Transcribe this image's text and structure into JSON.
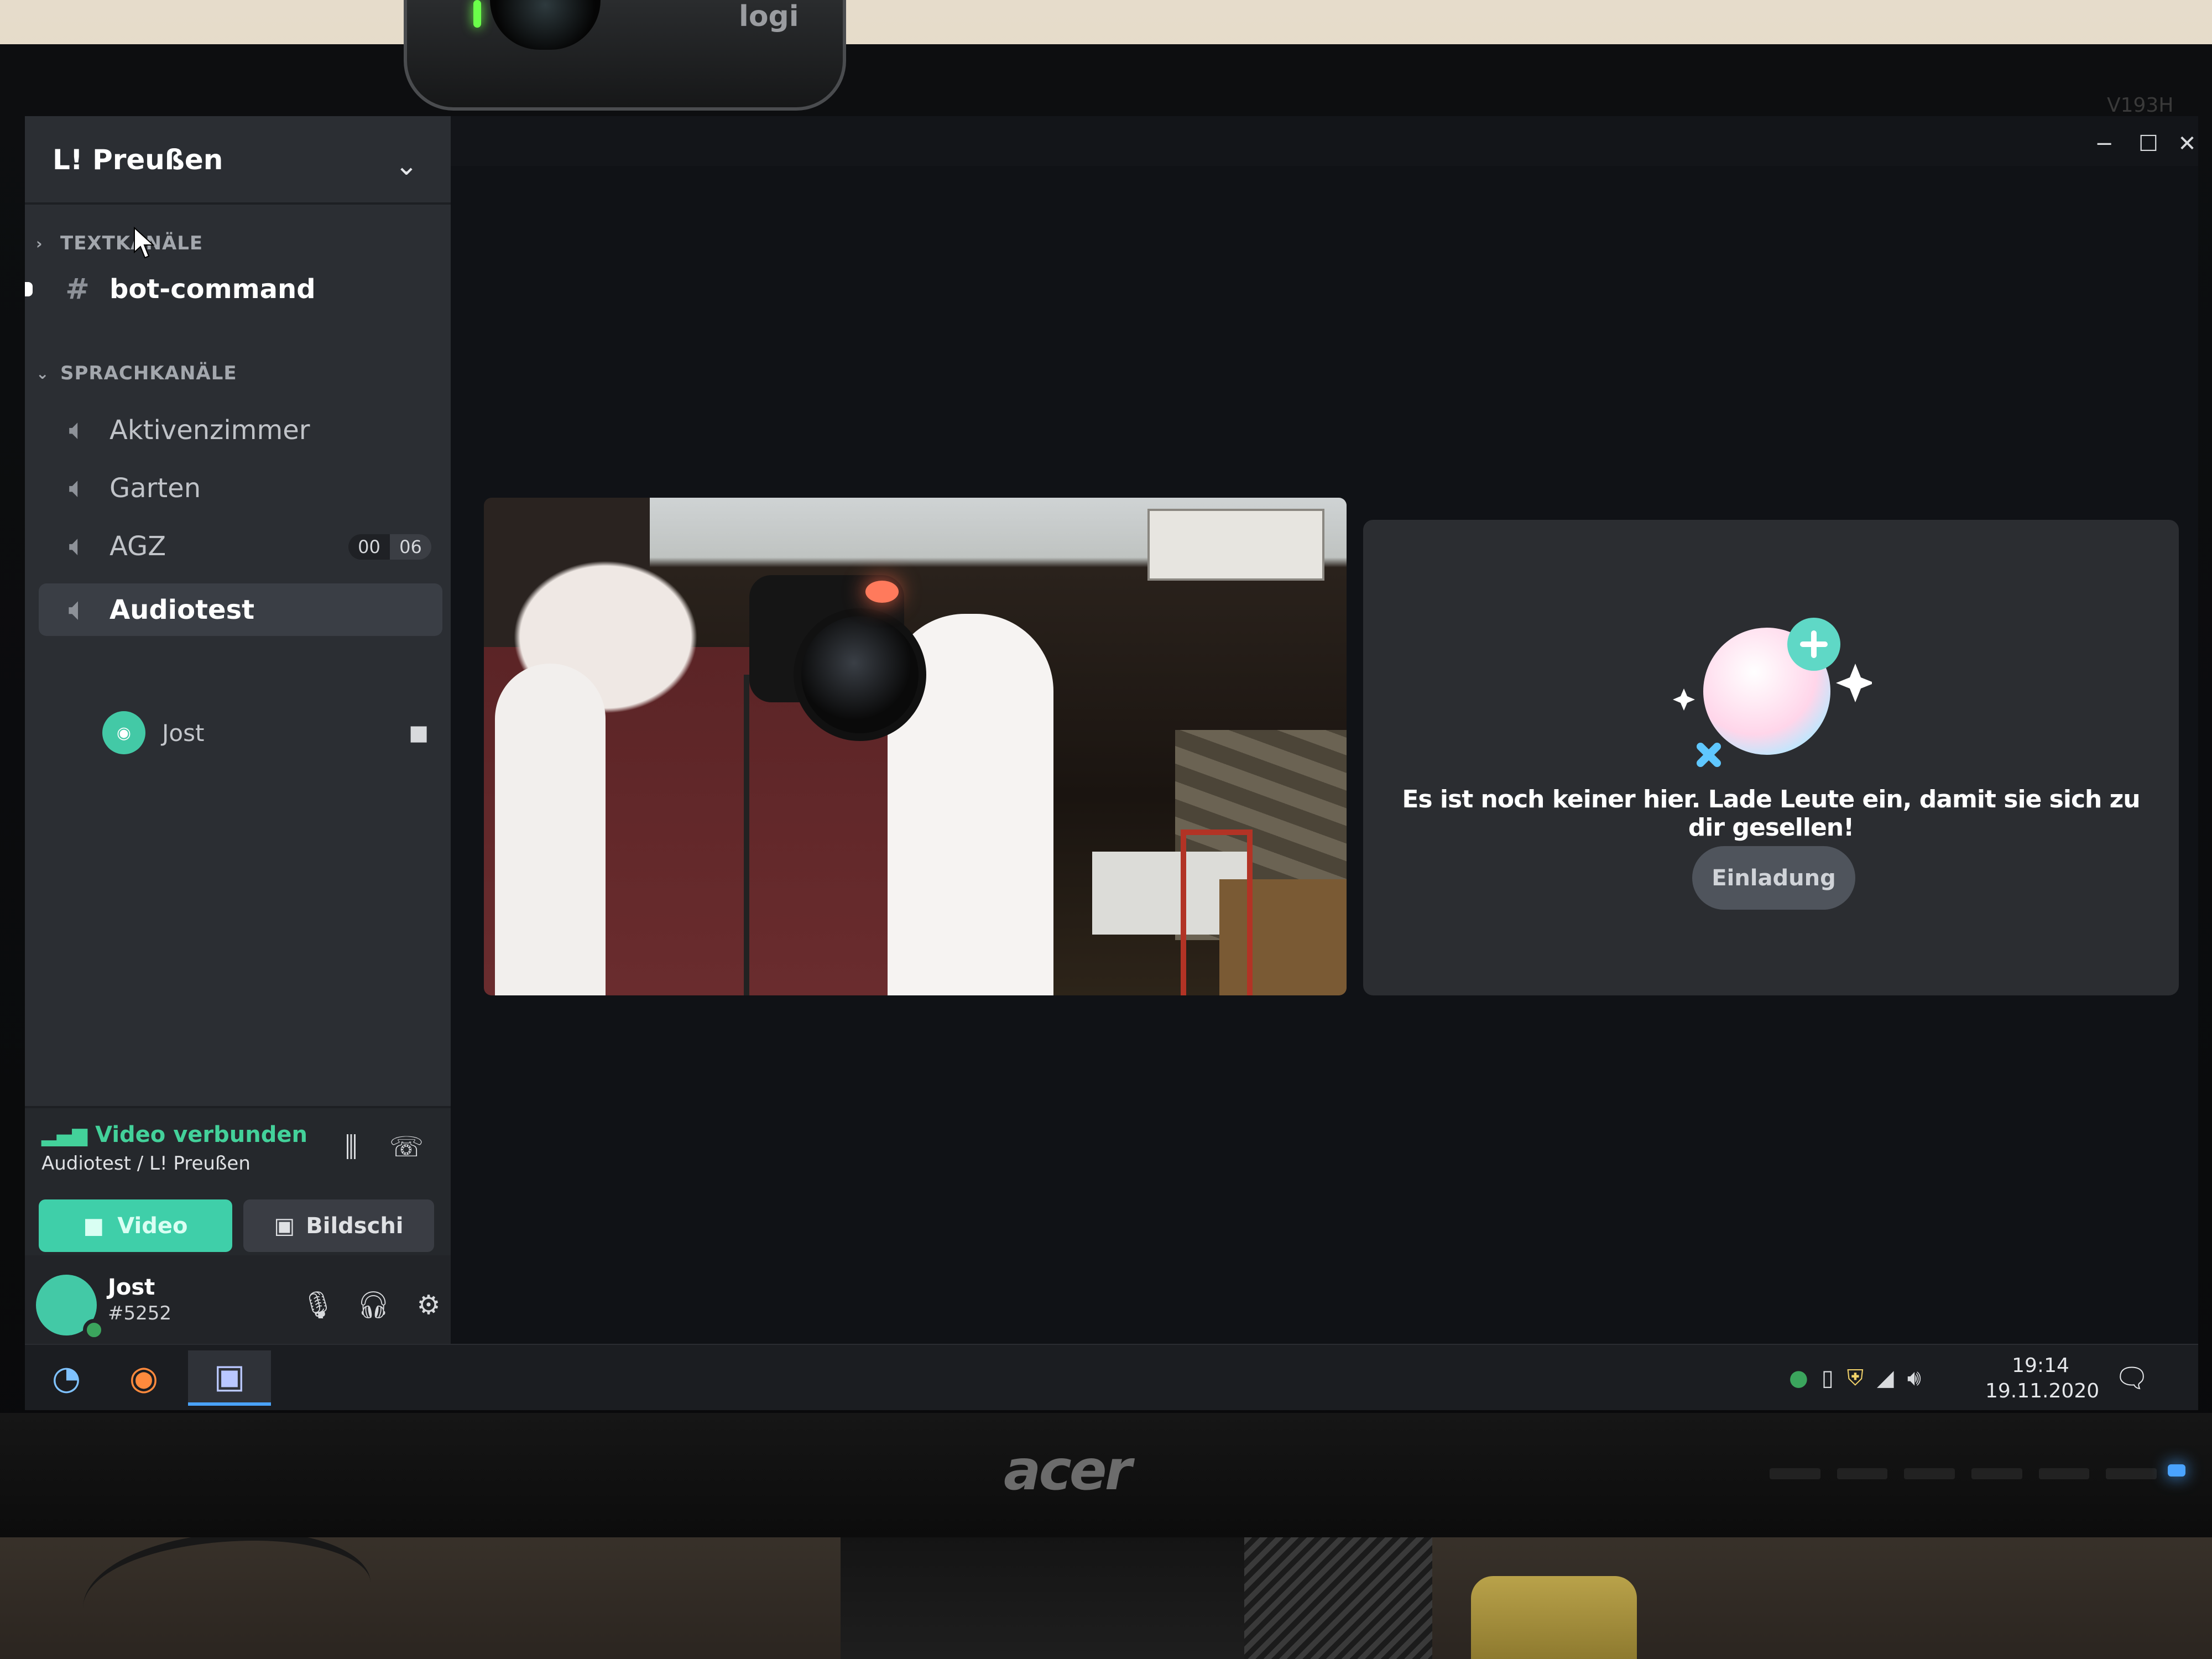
{
  "monitor": {
    "brand": "acer",
    "model": "V193H",
    "webcam_brand": "logi"
  },
  "server": {
    "name": "L! Preußen",
    "chevron_icon": "chevron-down-icon"
  },
  "categories": {
    "text": {
      "label": "TEXTKANÄLE",
      "collapsed": true
    },
    "voice": {
      "label": "SPRACHKANÄLE",
      "collapsed": false
    }
  },
  "text_channels": [
    {
      "name": "bot-command",
      "icon": "hash-icon"
    }
  ],
  "voice_channels": [
    {
      "name": "Aktivenzimmer",
      "icon": "speaker-icon"
    },
    {
      "name": "Garten",
      "icon": "speaker-icon"
    },
    {
      "name": "AGZ",
      "icon": "speaker-icon",
      "counter": [
        "00",
        "06"
      ]
    },
    {
      "name": "Audiotest",
      "icon": "speaker-icon",
      "selected": true
    }
  ],
  "voice_members": [
    {
      "name": "Jost",
      "camera_on": true
    }
  ],
  "connection": {
    "status": "Video verbunden",
    "location": "Audiotest / L! Preußen",
    "video_label": "Video",
    "screen_label": "Bildschi"
  },
  "user": {
    "name": "Jost",
    "tag": "#5252",
    "status": "online"
  },
  "call": {
    "empty_message": "Es ist noch keiner hier. Lade Leute ein, damit sie sich zu dir gesellen!",
    "invite_label": "Einladung"
  },
  "taskbar": {
    "time": "19:14",
    "date": "19.11.2020"
  },
  "colors": {
    "accent_green": "#43d19a",
    "video_button": "#3fcfa9",
    "sidebar_bg": "#2b2e33",
    "main_bg": "#101216",
    "tile_bg": "#2b2d31"
  }
}
